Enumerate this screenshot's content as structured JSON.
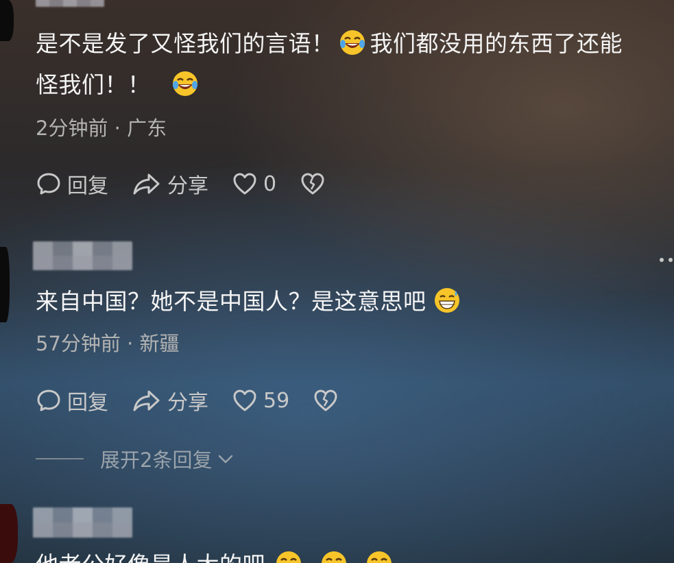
{
  "comments": [
    {
      "line1_text": "是不是发了又怪我们的言语！",
      "line1_text2": "我们都没用的东西了还能",
      "line2_text": "怪我们！！",
      "time_location": "2分钟前 · 广东",
      "actions": {
        "reply": "回复",
        "share": "分享",
        "likes": "0"
      }
    },
    {
      "text": "来自中国？她不是中国人？是这意思吧",
      "time_location": "57分钟前 · 新疆",
      "actions": {
        "reply": "回复",
        "share": "分享",
        "likes": "59"
      },
      "expand_label": "展开2条回复"
    },
    {
      "text": "他老公好像是人大的吧"
    }
  ],
  "icons": {
    "reply": "comment-bubble-icon",
    "share": "share-arrow-icon",
    "like": "heart-outline-icon",
    "dislike": "broken-heart-icon",
    "emoji_crying_laugh": "crying-laughing-emoji",
    "emoji_sweat_grin": "grinning-sweat-emoji",
    "more": "more-dots-icon",
    "chevron": "chevron-down-icon"
  },
  "colors": {
    "text": "#f4f4f4",
    "meta": "#b3b3b3",
    "action": "#c9c9c9",
    "expand": "#9aa3ab"
  }
}
